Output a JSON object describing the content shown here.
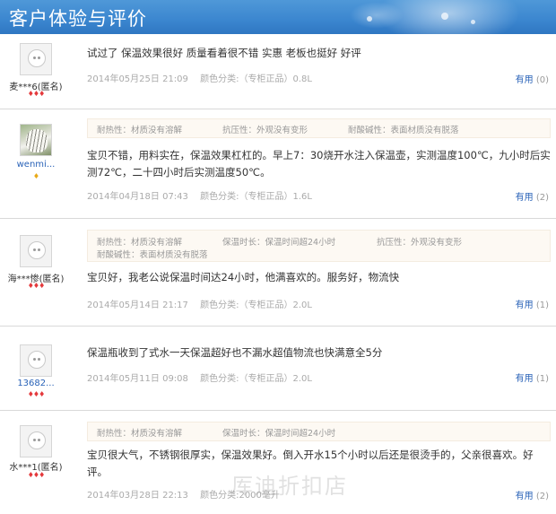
{
  "header": {
    "title": "客户体验与评价"
  },
  "reviews": [
    {
      "username": "麦***6(匿名)",
      "level": "♦♦♦",
      "tags": [],
      "text": "试过了 保温效果很好 质量看着很不错 实惠 老板也挺好 好评",
      "date": "2014年05月25日 21:09",
      "spec": "颜色分类:（专柜正品）0.8L",
      "useful_label": "有用",
      "useful_count": "(0)"
    },
    {
      "username": "wenmi...",
      "level": "♦",
      "tags": [
        "耐热性：材质没有溶解",
        "抗压性：外观没有变形",
        "耐酸碱性：表面材质没有脱落"
      ],
      "text": "宝贝不错，用料实在，保温效果杠杠的。早上7：30烧开水注入保温壶，实测温度100℃，九小时后实测72℃，二十四小时后实测温度50℃。",
      "date": "2014年04月18日 07:43",
      "spec": "颜色分类:（专柜正品）1.6L",
      "useful_label": "有用",
      "useful_count": "(2)"
    },
    {
      "username": "海***惨(匿名)",
      "level": "♦♦♦",
      "tags": [
        "耐热性：材质没有溶解",
        "保温时长：保温时间超24小时",
        "抗压性：外观没有变形",
        "耐酸碱性：表面材质没有脱落"
      ],
      "text": "宝贝好，我老公说保温时间达24小时，他满喜欢的。服务好，物流快",
      "date": "2014年05月14日 21:17",
      "spec": "颜色分类:（专柜正品）2.0L",
      "useful_label": "有用",
      "useful_count": "(1)"
    },
    {
      "username": "13682...",
      "level": "♦♦♦",
      "tags": [],
      "text": "保温瓶收到了式水一天保温超好也不漏水超值物流也快满意全5分",
      "date": "2014年05月11日 09:08",
      "spec": "颜色分类:（专柜正品）2.0L",
      "useful_label": "有用",
      "useful_count": "(1)"
    },
    {
      "username": "水***1(匿名)",
      "level": "♦♦♦",
      "tags": [
        "耐热性：材质没有溶解",
        "保温时长：保温时间超24小时"
      ],
      "text": "宝贝很大气，不锈钢很厚实，保温效果好。倒入开水15个小时以后还是很烫手的，父亲很喜欢。好评。",
      "date": "2014年03月28日 22:13",
      "spec": "颜色分类:2000毫升",
      "useful_label": "有用",
      "useful_count": "(2)"
    }
  ],
  "watermark": "厍迪折扣店",
  "colors": {
    "header": "#3b86cf",
    "link": "#2a63b8",
    "tag_bg": "#fdf9f3",
    "level_red": "#e4393c",
    "level_gold": "#e8a917"
  }
}
